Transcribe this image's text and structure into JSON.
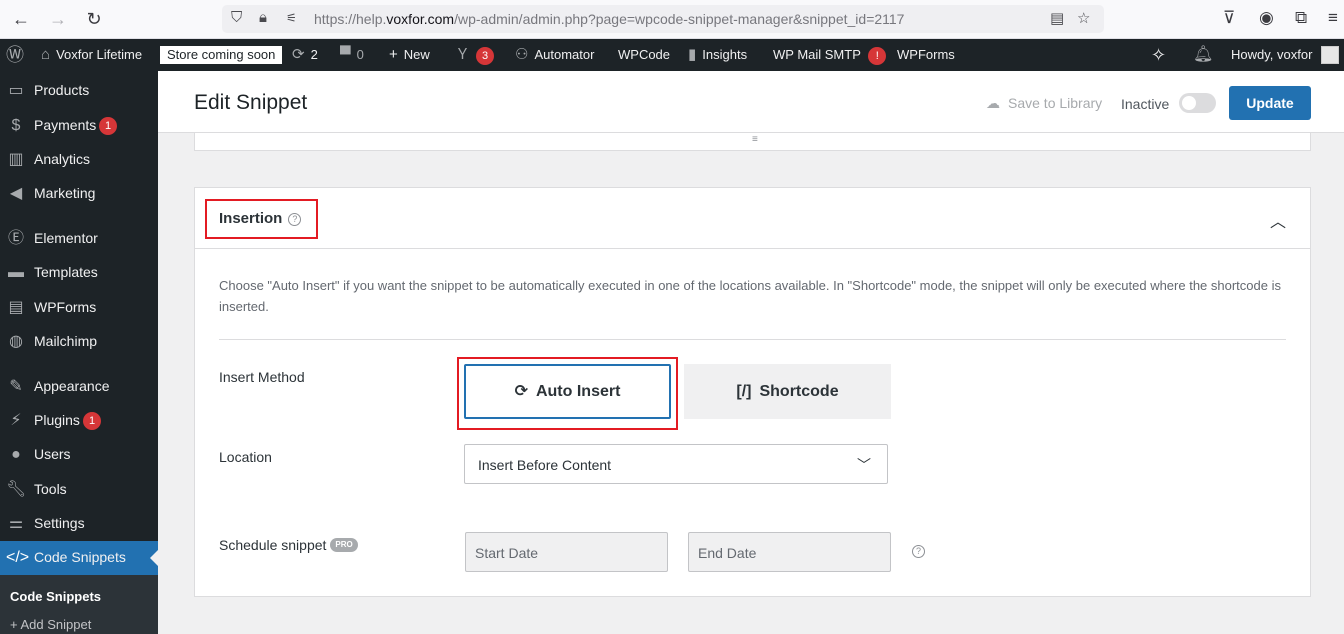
{
  "browser": {
    "url_prefix": "https://help.",
    "url_host": "voxfor.com",
    "url_path": "/wp-admin/admin.php?page=wpcode-snippet-manager&snippet_id=2117"
  },
  "adminbar": {
    "site_name": "Voxfor Lifetime",
    "store_badge": "Store coming soon",
    "updates_count": "2",
    "comments_count": "0",
    "new_label": "New",
    "yoast_count": "3",
    "automator": "Automator",
    "wpcode": "WPCode",
    "insights": "Insights",
    "wp_mail_smtp": "WP Mail SMTP",
    "smtp_alert": "!",
    "wpforms": "WPForms",
    "howdy": "Howdy, voxfor"
  },
  "sidebar": {
    "items": [
      {
        "label": "Products"
      },
      {
        "label": "Payments",
        "badge": "1"
      },
      {
        "label": "Analytics"
      },
      {
        "label": "Marketing"
      },
      {
        "label": "Elementor"
      },
      {
        "label": "Templates"
      },
      {
        "label": "WPForms"
      },
      {
        "label": "Mailchimp"
      },
      {
        "label": "Appearance"
      },
      {
        "label": "Plugins",
        "badge": "1"
      },
      {
        "label": "Users"
      },
      {
        "label": "Tools"
      },
      {
        "label": "Settings"
      },
      {
        "label": "Code Snippets"
      }
    ],
    "submenu": [
      "Code Snippets",
      "+ Add Snippet"
    ]
  },
  "header": {
    "title": "Edit Snippet",
    "save_to_library": "Save to Library",
    "status": "Inactive",
    "update": "Update"
  },
  "insertion": {
    "title": "Insertion",
    "description": "Choose \"Auto Insert\" if you want the snippet to be automatically executed in one of the locations available. In \"Shortcode\" mode, the snippet will only be executed where the shortcode is inserted.",
    "method_label": "Insert Method",
    "auto_insert": "Auto Insert",
    "shortcode": "Shortcode",
    "shortcode_glyph": "[/]",
    "location_label": "Location",
    "location_value": "Insert Before Content",
    "schedule_label": "Schedule snippet",
    "pro": "PRO",
    "start_date": "Start Date",
    "end_date": "End Date"
  }
}
